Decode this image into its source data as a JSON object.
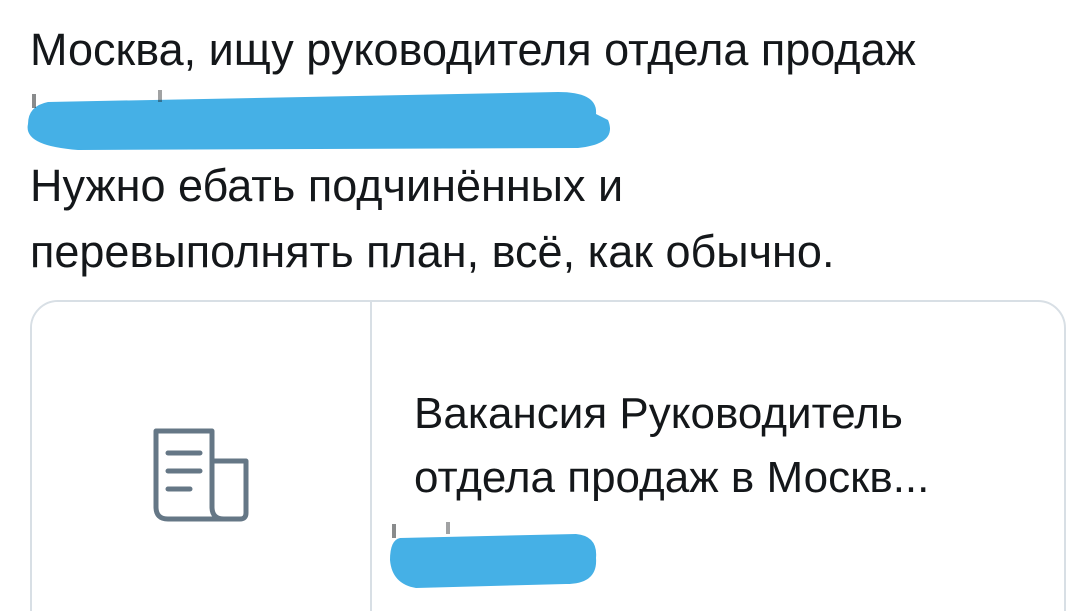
{
  "tweet": {
    "text_line_1": "Москва, ищу руководителя отдела продаж",
    "text_line_2": "Нужно ебать подчинённых и",
    "text_line_3": "перевыполнять план, всё, как обычно."
  },
  "link_card": {
    "icon": "document-icon",
    "title_line_1": "Вакансия Руководитель",
    "title_line_2": "отдела продаж в Москв..."
  },
  "colors": {
    "text": "#14171a",
    "border": "#d8dfe5",
    "redaction": "#45b0e6",
    "icon": "#657786"
  }
}
